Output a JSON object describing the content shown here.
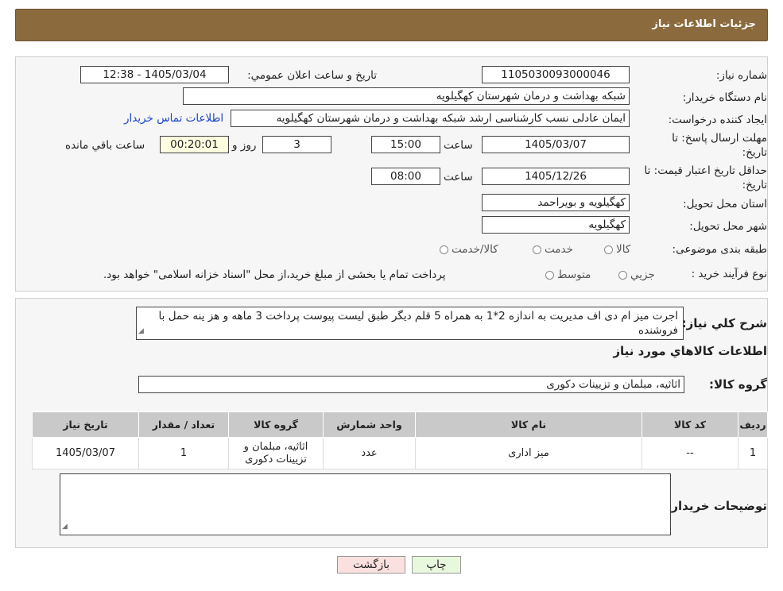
{
  "header": {
    "title": "جزئیات اطلاعات نیاز"
  },
  "form": {
    "need_number_label": "شماره نیاز:",
    "need_number": "1105030093000046",
    "announce_label": "تاریخ و ساعت اعلان عمومي:",
    "announce_value": "1405/03/04 - 12:38",
    "buyer_org_label": "نام دستگاه خریدار:",
    "buyer_org": "شبکه بهداشت و درمان شهرستان کهگیلویه",
    "creator_label": "ایجاد کننده درخواست:",
    "creator": "ایمان عادلی نسب کارشناسی ارشد شبکه بهداشت و درمان شهرستان کهگیلویه",
    "contact_link": "اطلاعات تماس خریدار",
    "deadline_label": "مهلت ارسال پاسخ: تا تاریخ:",
    "deadline_date": "1405/03/07",
    "time_label": "ساعت",
    "deadline_time": "15:00",
    "days_value": "3",
    "days_label": "روز و",
    "remaining_value": "00:20:01",
    "remaining_label": "ساعت باقي مانده",
    "validity_label": "حداقل تاریخ اعتبار قیمت: تا تاریخ:",
    "validity_date": "1405/12/26",
    "validity_time": "08:00",
    "province_label": "استان محل تحویل:",
    "province": "کهگیلویه و بویراحمد",
    "city_label": "شهر محل تحویل:",
    "city": "کهگیلویه",
    "category_label": "طبقه بندی موضوعی:",
    "category_options": [
      "کالا",
      "خدمت",
      "کالا/خدمت"
    ],
    "process_label": "نوع فرآیند خرید :",
    "process_options": [
      "جزیي",
      "متوسط"
    ],
    "process_note": "پرداخت تمام یا بخشی از مبلغ خرید،از محل \"اسناد خزانه اسلامی\" خواهد بود."
  },
  "general": {
    "desc_label": "شرح کلي نیاز:",
    "desc_text": "اجرت میز ام دی اف مدیریت به اندازه 2*1 به همراه 5 قلم دیگر طبق لیست پیوست پرداخت 3 ماهه و هز ینه حمل با فروشنده",
    "goods_info_title": "اطلاعات کالاهاي مورد نیاز",
    "goods_group_label": "گروه کالا:",
    "goods_group": "اثاثیه، مبلمان و تزیینات دکوری"
  },
  "table": {
    "headers": [
      "ردیف",
      "کد کالا",
      "نام کالا",
      "واحد شمارش",
      "گروه کالا",
      "تعداد / مقدار",
      "تاریخ نیاز"
    ],
    "rows": [
      [
        "1",
        "--",
        "میز اداری",
        "عدد",
        "اثاثیه، مبلمان و تزیینات دکوری",
        "1",
        "1405/03/07"
      ]
    ]
  },
  "buyer_notes": {
    "label": "توضیحات خریدار:",
    "value": ""
  },
  "buttons": {
    "print": "چاپ",
    "back": "بازگشت"
  }
}
